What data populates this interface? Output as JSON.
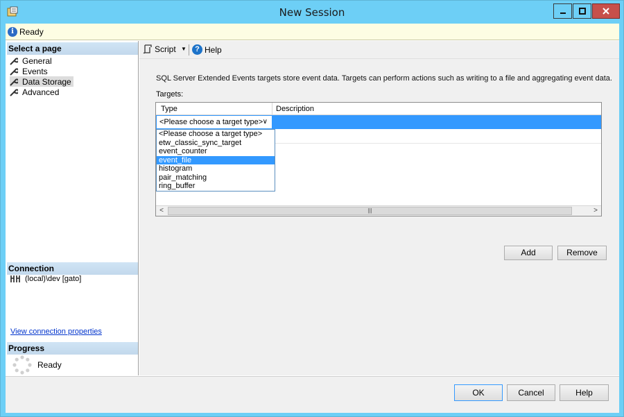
{
  "window": {
    "title": "New Session",
    "accent_color": "#6dcff6",
    "close_color": "#c7504b"
  },
  "status": {
    "text": "Ready",
    "icon": "info-icon"
  },
  "left_pane": {
    "select_page_header": "Select a page",
    "pages": [
      {
        "label": "General",
        "selected": false
      },
      {
        "label": "Events",
        "selected": false
      },
      {
        "label": "Data Storage",
        "selected": true
      },
      {
        "label": "Advanced",
        "selected": false
      }
    ],
    "connection_header": "Connection",
    "connection_value": "(local)\\dev [gato]",
    "connection_link": "View connection properties",
    "progress_header": "Progress",
    "progress_text": "Ready"
  },
  "toolbar": {
    "script_label": "Script",
    "help_label": "Help"
  },
  "main": {
    "description": "SQL Server Extended Events targets store event data. Targets can perform actions such as writing to a file and aggregating event data.",
    "targets_label": "Targets:",
    "columns": [
      "Type",
      "Description"
    ],
    "combo_value": "<Please choose a target type>",
    "dropdown_options": [
      {
        "label": "<Please choose a target type>",
        "selected": false
      },
      {
        "label": "etw_classic_sync_target",
        "selected": false
      },
      {
        "label": "event_counter",
        "selected": false
      },
      {
        "label": "event_file",
        "selected": true
      },
      {
        "label": "histogram",
        "selected": false
      },
      {
        "label": "pair_matching",
        "selected": false
      },
      {
        "label": "ring_buffer",
        "selected": false
      }
    ],
    "add_label": "Add",
    "remove_label": "Remove",
    "selection_color": "#3399ff"
  },
  "footer": {
    "ok_label": "OK",
    "cancel_label": "Cancel",
    "help_label": "Help"
  }
}
